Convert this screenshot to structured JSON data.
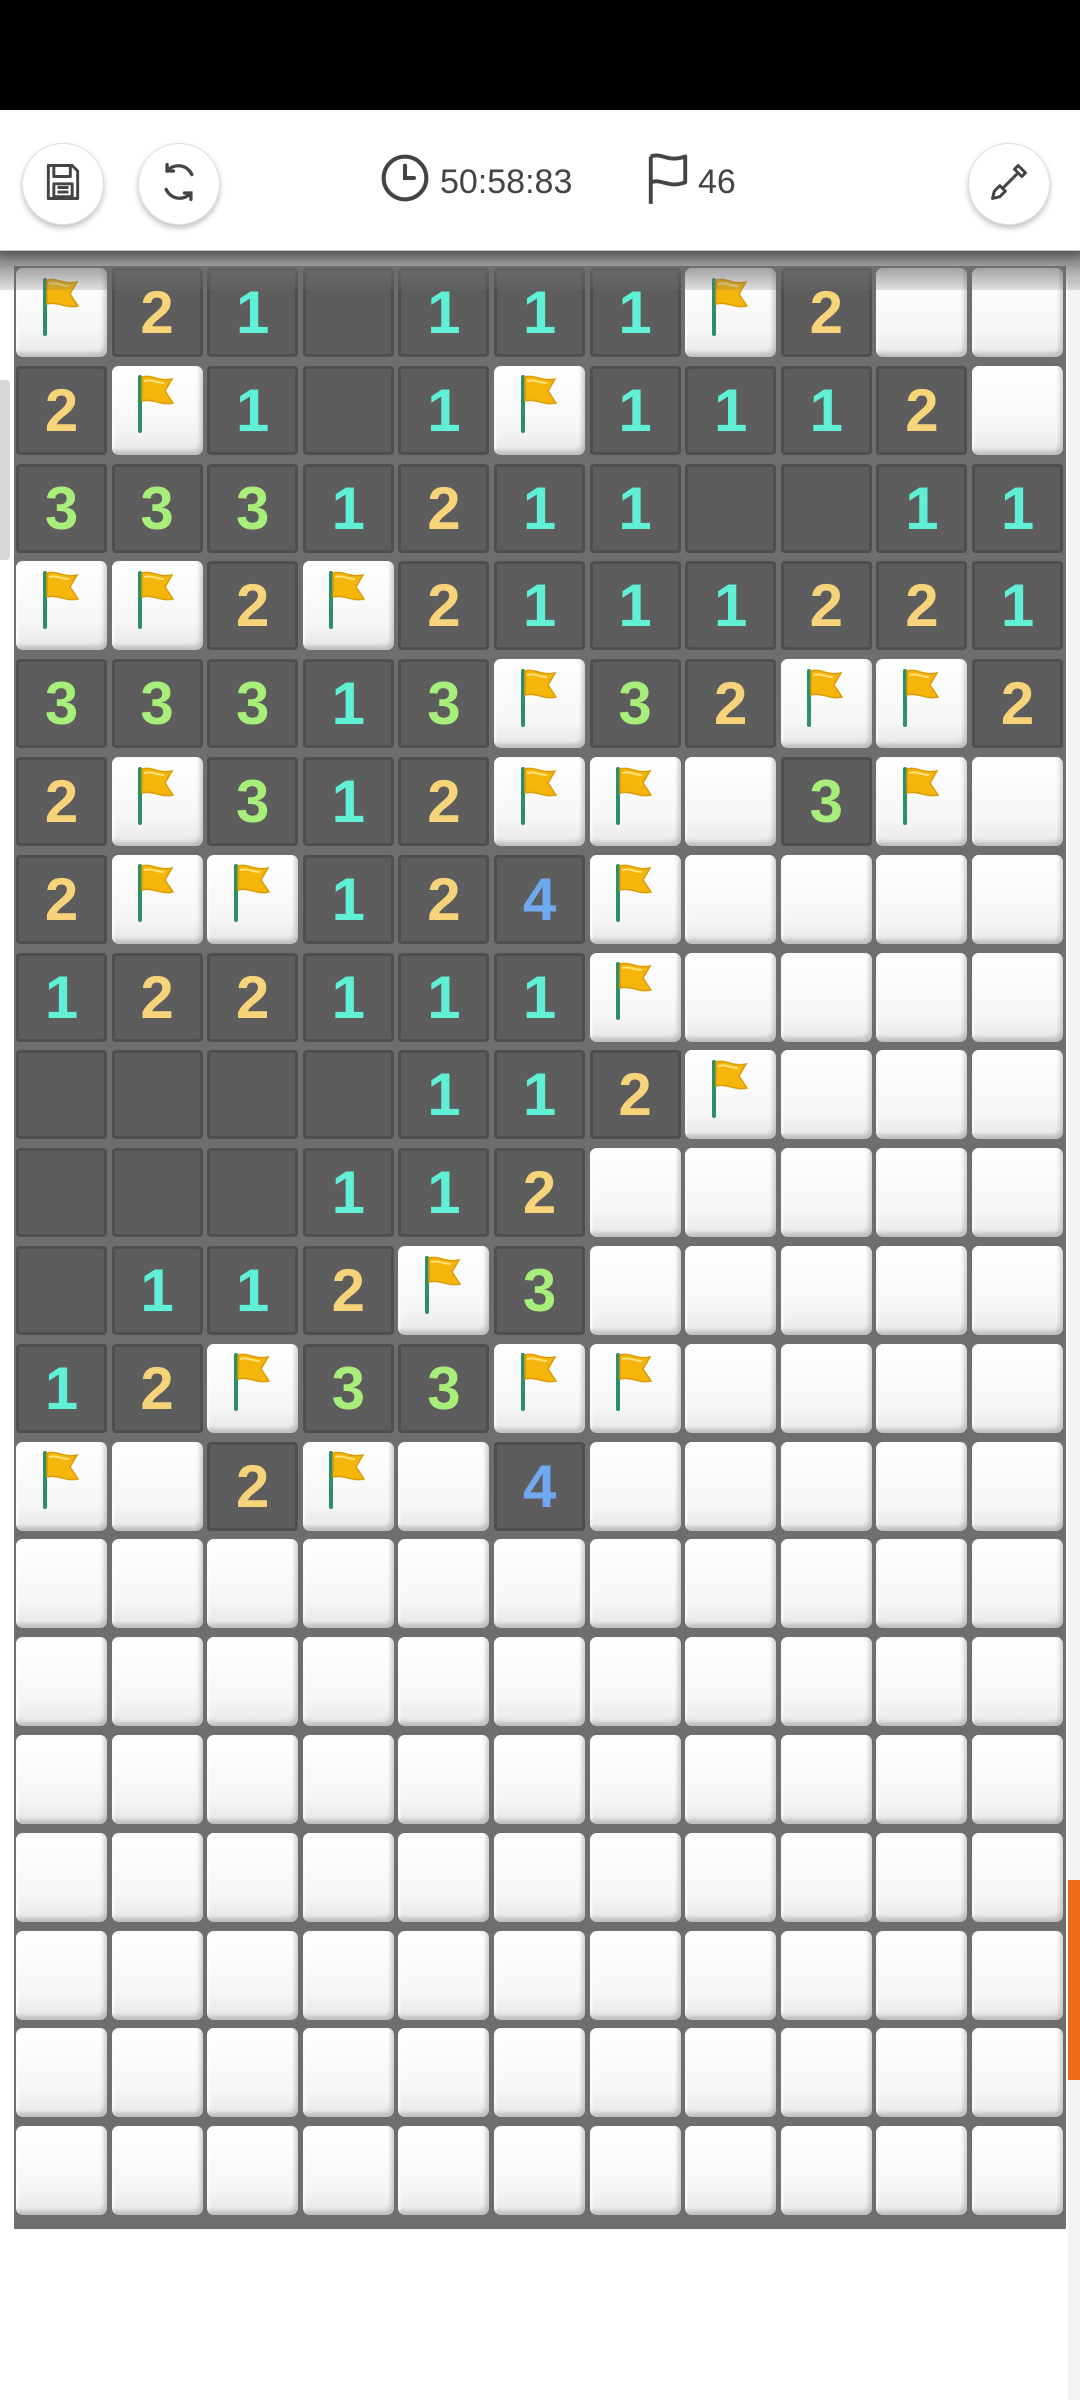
{
  "toolbar": {
    "timer_text": "50:58:83",
    "flags_text": "46",
    "save_icon": "save-icon",
    "restart_icon": "restart-icon",
    "tool_icon": "shovel-icon",
    "clock_icon": "clock-icon",
    "flag_icon": "flag-outline-icon"
  },
  "board": {
    "columns": 11,
    "rows": 20,
    "legend": {
      "H": "hidden",
      "F": "flag",
      "0": "revealed-empty",
      "1-8": "revealed-number"
    },
    "grid": [
      "F210111F2H",
      "2F101F1112H",
      "33312110011",
      "FF2F2111221",
      "33313F32FF2",
      "2F312FFH3FH",
      "2FF124FHHHH",
      "122111FHHHH",
      "0000112FHHHH",
      "000112HHHHH",
      "0112F3HHHHH",
      "12F33FFHHHH",
      "FH2FH4HHHHH",
      "HHHHHHHHHHH",
      "HHHHHHHHHHH",
      "HHHHHHHHHHH",
      "HHHHHHHHHHH",
      "HHHHHHHHHHH",
      "HHHHHHHHHHH",
      "HHHHHHHHHHH"
    ],
    "number_colors": {
      "1": "#5ff0d6",
      "2": "#f7d37a",
      "3": "#a8ee7a",
      "4": "#6fa9f0"
    },
    "flag_color": "#f5b50a"
  },
  "colors": {
    "revealed": "#5d5d5d",
    "grid_lines": "#6e6e6e",
    "scroll_accent": "#f26b17"
  }
}
